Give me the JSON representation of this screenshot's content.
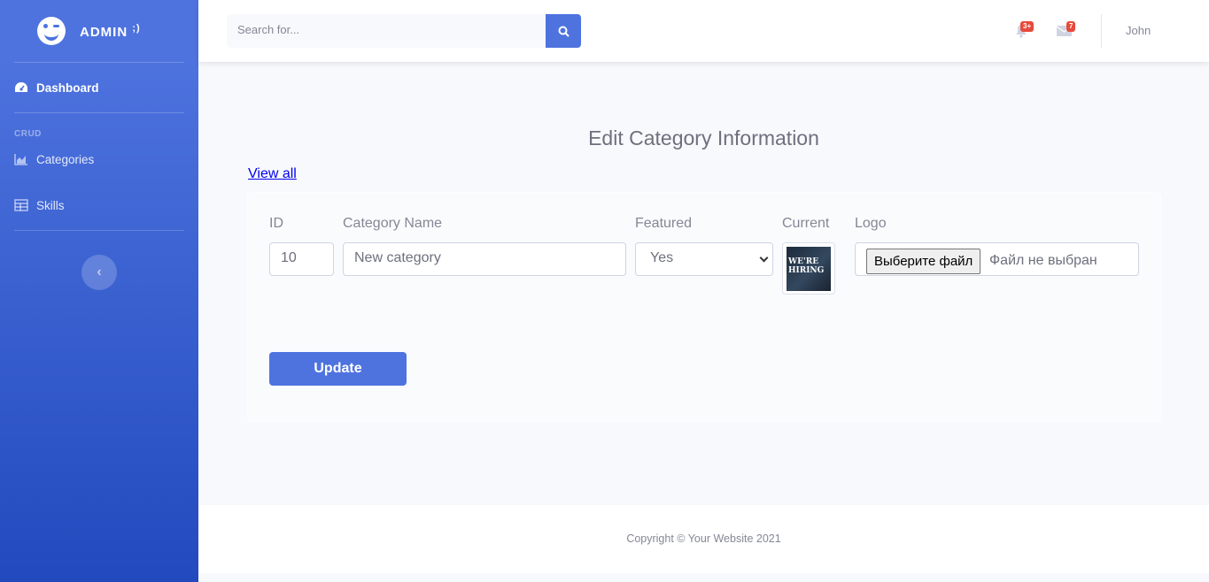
{
  "sidebar": {
    "brand": "ADMIN",
    "brand_suffix": ";)",
    "dashboard": "Dashboard",
    "heading": "CRUD",
    "items": [
      {
        "label": "Categories",
        "icon": "chart-area-icon"
      },
      {
        "label": "Skills",
        "icon": "table-icon"
      }
    ],
    "toggle_icon": "chevron-left-icon"
  },
  "topbar": {
    "search_placeholder": "Search for...",
    "alerts_badge": "3+",
    "messages_badge": "7",
    "user": "John"
  },
  "form": {
    "title": "Edit Category Information",
    "view_all": "View all",
    "id_label": "ID",
    "id_value": "10",
    "name_label": "Category Name",
    "name_value": "New category",
    "featured_label": "Featured",
    "featured_value": "Yes",
    "current_label": "Current",
    "current_image_text": "WE'RE HIRING",
    "logo_label": "Logo",
    "file_button": "Выберите файл",
    "file_status": "Файл не выбран",
    "submit": "Update"
  },
  "footer": {
    "copyright": "Copyright © Your Website 2021"
  },
  "colors": {
    "primary": "#4e73df",
    "primary_dark": "#224abe",
    "badge": "#e74a3b",
    "text_muted": "#858796",
    "background": "#f8f9fc"
  }
}
